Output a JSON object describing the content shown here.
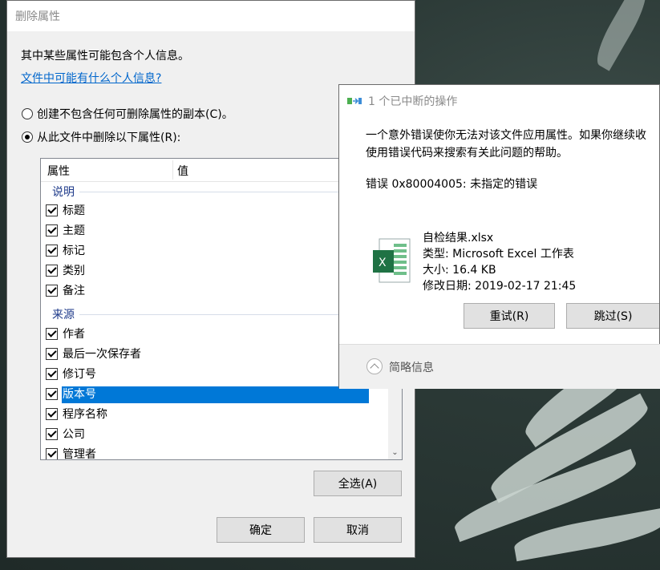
{
  "props_dialog": {
    "title": "删除属性",
    "info_text": "其中某些属性可能包含个人信息。",
    "info_link": "文件中可能有什么个人信息?",
    "radio_copy_label": "创建不包含任何可删除属性的副本(C)。",
    "radio_remove_label": "从此文件中删除以下属性(R):",
    "list": {
      "col_property": "属性",
      "col_value": "值",
      "groups": [
        {
          "name": "说明",
          "items": [
            "标题",
            "主题",
            "标记",
            "类别",
            "备注"
          ]
        },
        {
          "name": "来源",
          "items": [
            "作者",
            "最后一次保存者",
            "修订号",
            "版本号",
            "程序名称",
            "公司",
            "管理者"
          ]
        }
      ],
      "selected_item": "版本号"
    },
    "select_all_button": "全选(A)",
    "ok_button": "确定",
    "cancel_button": "取消"
  },
  "error_dialog": {
    "title": "1 个已中断的操作",
    "message_line1": "一个意外错误使你无法对该文件应用属性。如果你继续收",
    "message_line2": "使用错误代码来搜索有关此问题的帮助。",
    "error_code": "错误 0x80004005: 未指定的错误",
    "file": {
      "name": "自检结果.xlsx",
      "type": "类型: Microsoft Excel 工作表",
      "size": "大小: 16.4 KB",
      "modified": "修改日期: 2019-02-17 21:45"
    },
    "retry_button": "重试(R)",
    "skip_button": "跳过(S)",
    "details_toggle": "简略信息"
  },
  "colors": {
    "selection": "#0078d7",
    "link": "#0066cc",
    "excel_green": "#1f7244"
  },
  "icons": [
    "radio-icon",
    "checkbox-icon",
    "chevron-down-icon",
    "excel-file-icon",
    "copy-progress-icon",
    "chevron-up-icon"
  ]
}
